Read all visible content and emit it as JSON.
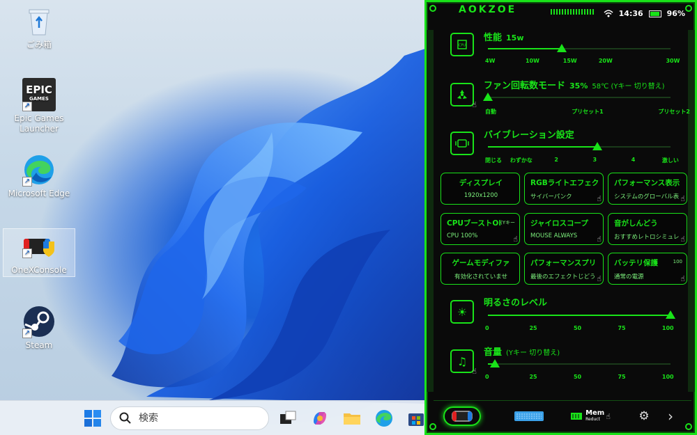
{
  "desktop": {
    "icons": [
      {
        "label": "ごみ箱"
      },
      {
        "label": "Epic Games Launcher",
        "logo_line1": "EPIC",
        "logo_line2": "GAMES"
      },
      {
        "label": "Microsoft Edge"
      },
      {
        "label": "OneXConsole"
      },
      {
        "label": "Steam"
      }
    ]
  },
  "taskbar": {
    "search_placeholder": "検索"
  },
  "panel": {
    "brand": "AOKZOE",
    "status": {
      "time": "14:36",
      "battery": "96%"
    },
    "performance": {
      "title": "性能",
      "value": "15w",
      "level": 0.405,
      "ticks": [
        "4W",
        "10W",
        "15W",
        "20W",
        "30W"
      ]
    },
    "fan": {
      "title": "ファン回転数モード",
      "value": "35%",
      "extra": "58℃ (Yキー 切り替え)",
      "level": 0.0,
      "ticks": [
        "自動",
        "プリセット1",
        "プリセット2"
      ]
    },
    "vibration": {
      "title": "バイブレーション設定",
      "level": 0.6,
      "ticks": [
        "閉じる",
        "わずかな",
        "2",
        "3",
        "4",
        "激しい"
      ]
    },
    "tiles": [
      {
        "t1": "ディスプレイ",
        "t2": "1920x1200"
      },
      {
        "t1": "RGBライトエフェクト",
        "t2": "サイバーパンク"
      },
      {
        "t1": "パフォーマンス表示",
        "t2": "システムのグローバル表"
      },
      {
        "t1": "CPUブーストON",
        "t1_extra": "(Yキー",
        "t2": "CPU 100%"
      },
      {
        "t1": "ジャイロスコープ",
        "t2": "MOUSE ALWAYS"
      },
      {
        "t1": "音がしんどう",
        "t2": "おすすめレトロシミュレ"
      },
      {
        "t1": "ゲームモディファ",
        "t2": "有効化されていませ"
      },
      {
        "t1": "パフォーマンスプリ",
        "t2": "最後のエフェクトじどう"
      },
      {
        "t1": "バッテリ保護",
        "t1_extra": "100",
        "t2": "通常の電源"
      }
    ],
    "brightness": {
      "title": "明るさのレベル",
      "level": 1.0,
      "ticks": [
        "0",
        "25",
        "50",
        "75",
        "100"
      ]
    },
    "volume": {
      "title": "音量",
      "extra": "(Yキー 切り替え)",
      "level": 0.04,
      "ticks": [
        "0",
        "25",
        "50",
        "75",
        "100"
      ]
    },
    "bottom_nav": {
      "mem_label": "Mem",
      "mem_sub": "Reduct"
    }
  },
  "colors": {
    "accent": "#19e319",
    "panel_bg": "#0a0a0a"
  }
}
